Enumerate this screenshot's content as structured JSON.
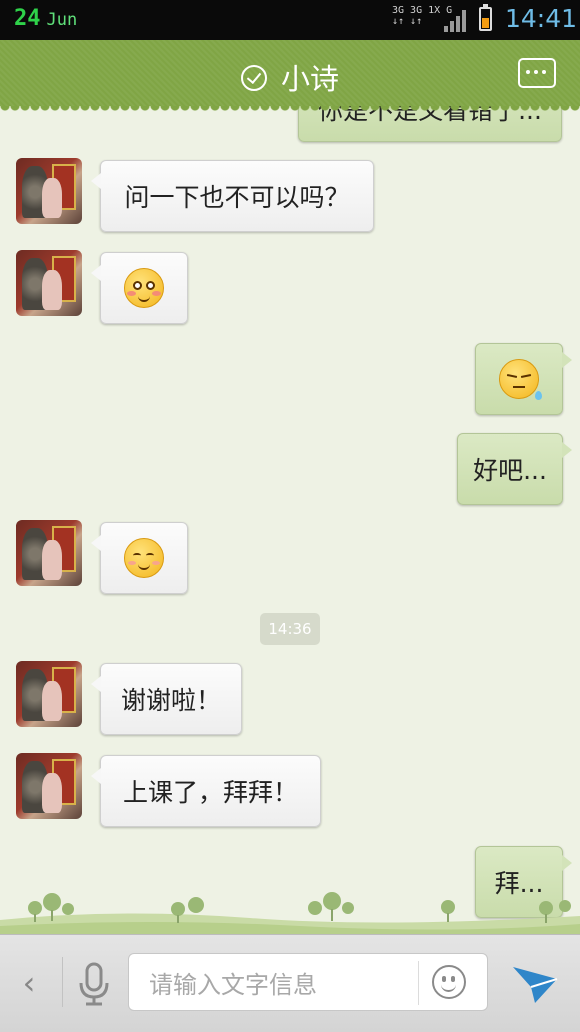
{
  "status_bar": {
    "date_day": "24",
    "date_month": "Jun",
    "network_line1": "3G 3G 1X  G",
    "network_line2": "↓↑  ↓↑",
    "time": "14:41",
    "battery_level": 0.55,
    "accent_color": "#2fd24a"
  },
  "header": {
    "title": "小诗",
    "status_icon": "check-circle-icon",
    "menu_icon": "more-dots-icon",
    "color": "#80a545"
  },
  "messages": [
    {
      "side": "out",
      "type": "text",
      "text": "你是不是又看错了..."
    },
    {
      "side": "in",
      "type": "text",
      "text": "问一下也不可以吗？"
    },
    {
      "side": "in",
      "type": "emoji",
      "emoji": "shy-emoji"
    },
    {
      "side": "out",
      "type": "emoji",
      "emoji": "annoyed-sweat-emoji"
    },
    {
      "side": "out",
      "type": "text",
      "text": "好吧..."
    },
    {
      "side": "in",
      "type": "emoji",
      "emoji": "smile-emoji"
    },
    {
      "side": "time",
      "type": "timestamp",
      "text": "14:36"
    },
    {
      "side": "in",
      "type": "text",
      "text": "谢谢啦！"
    },
    {
      "side": "in",
      "type": "text",
      "text": "上课了，拜拜！"
    },
    {
      "side": "out",
      "type": "text",
      "text": "拜..."
    }
  ],
  "input_bar": {
    "placeholder": "请输入文字信息",
    "back_icon": "chevron-left-icon",
    "mic_icon": "microphone-icon",
    "emoji_icon": "smiley-icon",
    "send_icon": "send-arrow-icon",
    "send_color": "#2f86c9"
  }
}
